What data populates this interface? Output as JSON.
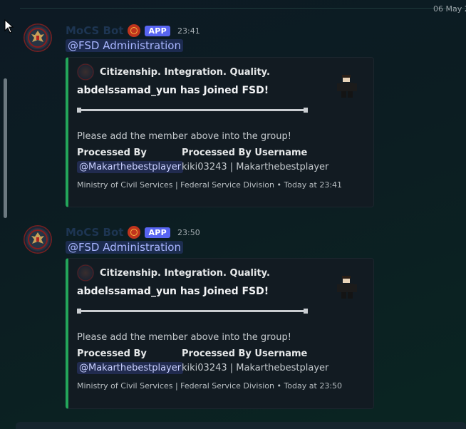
{
  "date_divider": "06 May 2",
  "messages": [
    {
      "author": "MoCS Bot",
      "app_tag": "APP",
      "time": "23:41",
      "mention": "@FSD Administration",
      "embed": {
        "author_name": "Citizenship. Integration. Quality.",
        "title": "abdelssamad_yun has Joined FSD!",
        "description": "Please add the member above into the group!",
        "field1_name": "Processed By",
        "field1_value": "@Makarthebestplayer",
        "field2_name": "Processed By Username",
        "field2_value": "kiki03243 | Makarthebestplayer",
        "footer": "Ministry of Civil Services | Federal Service Division • Today at 23:41",
        "accent_color": "#23a55a"
      }
    },
    {
      "author": "MoCS Bot",
      "app_tag": "APP",
      "time": "23:50",
      "mention": "@FSD Administration",
      "embed": {
        "author_name": "Citizenship. Integration. Quality.",
        "title": "abdelssamad_yun has Joined FSD!",
        "description": "Please add the member above into the group!",
        "field1_name": "Processed By",
        "field1_value": "@Makarthebestplayer",
        "field2_name": "Processed By Username",
        "field2_value": "kiki03243 | Makarthebestplayer",
        "footer": "Ministry of Civil Services | Federal Service Division • Today at 23:50",
        "accent_color": "#23a55a"
      }
    }
  ],
  "icons": {
    "avatar": "bot-avatar-emblem",
    "badge": "emblem-badge-icon",
    "thumbnail": "roblox-avatar-thumbnail"
  }
}
